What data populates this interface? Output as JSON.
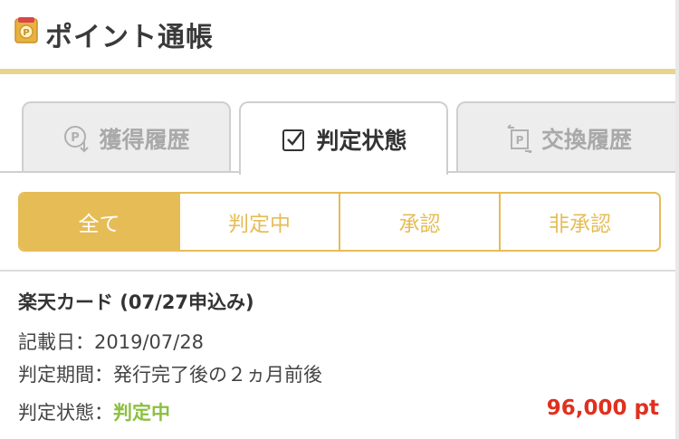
{
  "header": {
    "title": "ポイント通帳",
    "icon": "point-passbook-icon",
    "rule_color": "#e8d48e"
  },
  "tabs": [
    {
      "label": "獲得履歴",
      "icon": "point-earn-icon",
      "active": false
    },
    {
      "label": "判定状態",
      "icon": "checklist-icon",
      "active": true
    },
    {
      "label": "交換履歴",
      "icon": "point-exchange-icon",
      "active": false
    }
  ],
  "filter": {
    "accent_color": "#e6bc57",
    "options": [
      {
        "label": "全て",
        "active": true
      },
      {
        "label": "判定中",
        "active": false
      },
      {
        "label": "承認",
        "active": false
      },
      {
        "label": "非承認",
        "active": false
      }
    ]
  },
  "entry": {
    "title": "楽天カード (07/27申込み)",
    "date_line": "記載日：2019/07/28",
    "period_line": "判定期間：発行完了後の２ヵ月前後",
    "status_label": "判定状態：",
    "status_value": "判定中",
    "status_color": "#8bc03f",
    "points": "96,000 pt",
    "points_color": "#e0301e"
  }
}
